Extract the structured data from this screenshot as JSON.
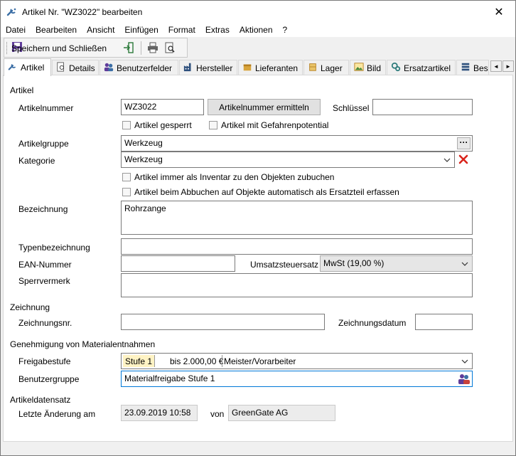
{
  "window": {
    "title": "Artikel Nr. \"WZ3022\" bearbeiten",
    "close_glyph": "✕"
  },
  "menu": [
    "Datei",
    "Bearbeiten",
    "Ansicht",
    "Einfügen",
    "Format",
    "Extras",
    "Aktionen",
    "?"
  ],
  "toolbar": {
    "save_label": "Speichern und Schließen"
  },
  "tabs": [
    "Artikel",
    "Details",
    "Benutzerfelder",
    "Hersteller",
    "Lieferanten",
    "Lager",
    "Bild",
    "Ersatzartikel",
    "Bes"
  ],
  "tab_scroll": {
    "left": "◄",
    "right": "►"
  },
  "sections": {
    "artikel": "Artikel",
    "zeichnung": "Zeichnung",
    "genehmigung": "Genehmigung von Materialentnahmen",
    "artikeldatensatz": "Artikeldatensatz"
  },
  "labels": {
    "artikelnummer": "Artikelnummer",
    "schluessel": "Schlüssel",
    "artikelgruppe": "Artikelgruppe",
    "kategorie": "Kategorie",
    "bezeichnung": "Bezeichnung",
    "typenbezeichnung": "Typenbezeichnung",
    "ean": "EAN-Nummer",
    "umsatzsteuer": "Umsatzsteuersatz",
    "sperrvermerk": "Sperrvermerk",
    "zeichnungsnr": "Zeichnungsnr.",
    "zeichnungsdatum": "Zeichnungsdatum",
    "freigabestufe": "Freigabestufe",
    "benutzergruppe": "Benutzergruppe",
    "letzte_aenderung": "Letzte Änderung am",
    "von": "von"
  },
  "values": {
    "artikelnummer": "WZ3022",
    "schluessel": "",
    "artikelgruppe": "Werkzeug",
    "kategorie": "Werkzeug",
    "bezeichnung": "Rohrzange",
    "typenbezeichnung": "",
    "ean": "",
    "umsatzsteuer": "MwSt (19,00 %)",
    "sperrvermerk": "",
    "zeichnungsnr": "",
    "zeichnungsdatum": " .  .",
    "freigabestufe_stufe": "Stufe 1",
    "freigabestufe_betrag": "bis 2.000,00 €",
    "freigabestufe_rolle": "Meister/Vorarbeiter",
    "benutzergruppe": "Materialfreigabe Stufe 1",
    "letzte_aenderung": "23.09.2019 10:58",
    "geaendert_von": "GreenGate AG"
  },
  "buttons": {
    "artikelnummer_ermitteln": "Artikelnummer ermitteln",
    "dots": "···"
  },
  "checkboxes": {
    "gesperrt": "Artikel gesperrt",
    "gefahrenpotential": "Artikel mit Gefahrenpotential",
    "inventar": "Artikel immer als Inventar zu den Objekten zubuchen",
    "ersatzteil": "Artikel beim Abbuchen auf Objekte automatisch als Ersatzteil erfassen"
  },
  "colors": {
    "delete_red": "#d9241b",
    "accent_blue": "#0078d7"
  }
}
